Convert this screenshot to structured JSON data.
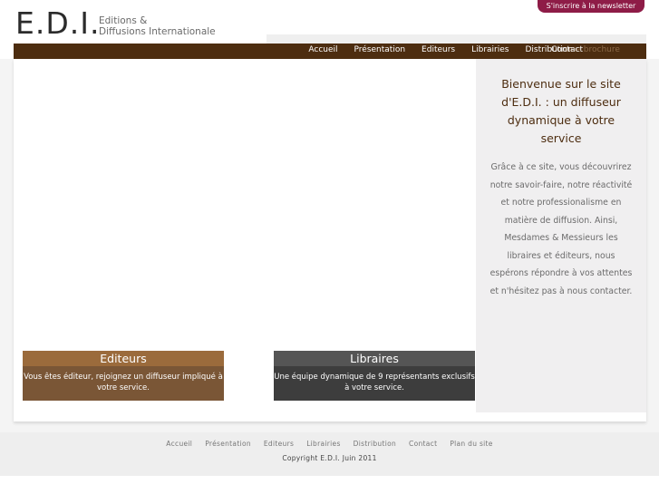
{
  "header": {
    "logo": "E.D.I.",
    "logo_line1": "Editions &",
    "logo_line2": "Diffusions Internationale",
    "newsletter": "S'inscrire à la newsletter"
  },
  "nav": {
    "items": [
      "Accueil",
      "Présentation",
      "Editeurs",
      "Librairies",
      "Distribution"
    ],
    "brochure": "une brochure",
    "contact": "Contact"
  },
  "promos": {
    "editeurs": {
      "title": "Editeurs",
      "text": "Vous êtes éditeur, rejoignez un diffuseur impliqué à votre service."
    },
    "libraires": {
      "title": "Libraires",
      "text": "Une équipe dynamique de 9 représentants exclusifs à votre service."
    }
  },
  "sidebar": {
    "title": "Bienvenue sur le site d'E.D.I. : un diffuseur dynamique à votre service",
    "text": "Grâce à ce site, vous découvrirez notre savoir-faire, notre réactivité et notre professionalisme en matière de diffusion. Ainsi, Mesdames & Messieurs les libraires et éditeurs, nous espérons répondre à vos attentes et n'hésitez pas à nous contacter."
  },
  "footer": {
    "links": [
      "Accueil",
      "Présentation",
      "Editeurs",
      "Librairies",
      "Distribution",
      "Contact",
      "Plan du site"
    ],
    "copyright": "Copyright E.D.I. Juin 2011"
  },
  "colors": {
    "nav_brown": "#4d2d10",
    "newsletter_magenta": "#8e1c47",
    "editeurs_brown": "#9b6b3c",
    "libraires_gray": "#555555"
  }
}
